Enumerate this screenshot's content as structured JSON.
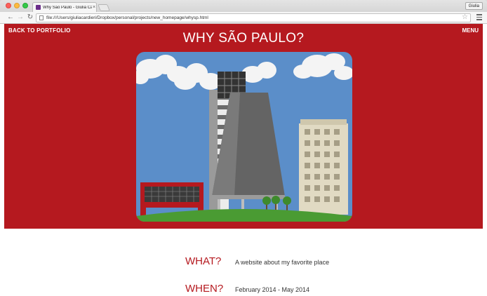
{
  "browser": {
    "tab_title": "Why São Paulo - Giulia Ca",
    "tab_close": "×",
    "user_label": "Giulia",
    "url": "file:///Users/giuliacardieri/Dropbox/personal/projects/new_homepage/whysp.html"
  },
  "page": {
    "nav_back": "BACK TO PORTFOLIO",
    "nav_menu": "MENU",
    "title": "WHY SÃO PAULO?",
    "items": [
      {
        "label": "WHAT?",
        "value": "A website about my favorite place"
      },
      {
        "label": "WHEN?",
        "value": "February 2014 - May 2014"
      }
    ]
  },
  "colors": {
    "brand_red": "#b5191f",
    "sky": "#5b8ec9",
    "grass": "#4a9b33"
  }
}
